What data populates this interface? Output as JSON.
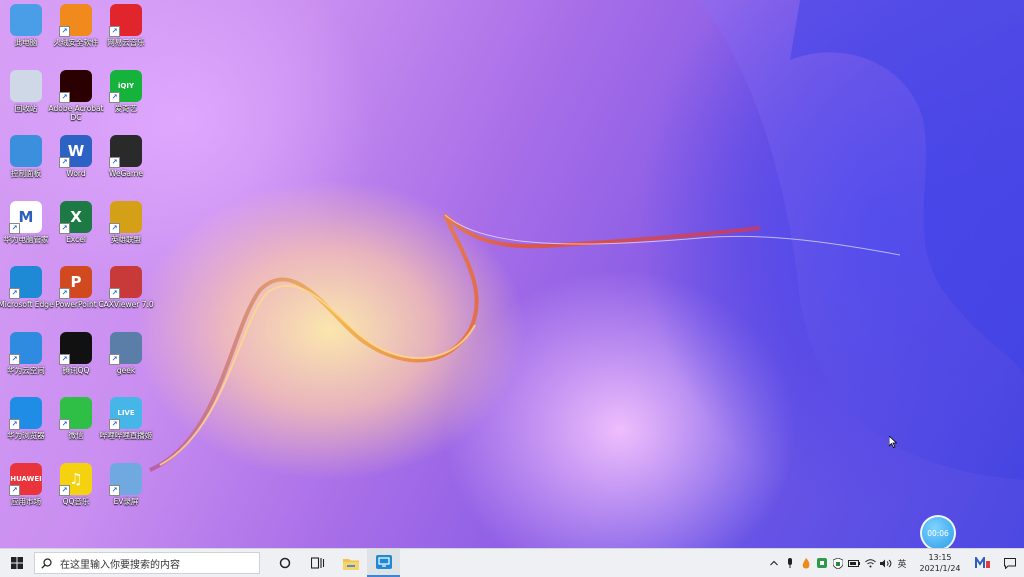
{
  "desktop": {
    "icons": [
      {
        "label": "此电脑",
        "glyph": "",
        "color": "#4a9ee8",
        "shortcut": false
      },
      {
        "label": "火绒安全软件",
        "glyph": "",
        "color": "#f08a1c",
        "shortcut": true
      },
      {
        "label": "网易云音乐",
        "glyph": "",
        "color": "#e0262c",
        "shortcut": true
      },
      {
        "label": "回收站",
        "glyph": "",
        "color": "#cfd8e6",
        "shortcut": false
      },
      {
        "label": "Adobe Acrobat DC",
        "glyph": "",
        "color": "#2b0000",
        "shortcut": true
      },
      {
        "label": "爱奇艺",
        "glyph": "iQIY",
        "color": "#16b33c",
        "shortcut": true
      },
      {
        "label": "控制面板",
        "glyph": "",
        "color": "#3c8fdc",
        "shortcut": false
      },
      {
        "label": "Word",
        "glyph": "W",
        "color": "#2b62c4",
        "shortcut": true
      },
      {
        "label": "WeGame",
        "glyph": "",
        "color": "#2a2a2a",
        "shortcut": true
      },
      {
        "label": "华为电脑管家",
        "glyph": "M",
        "color": "#ffffff",
        "shortcut": true
      },
      {
        "label": "Excel",
        "glyph": "X",
        "color": "#1d7a44",
        "shortcut": true
      },
      {
        "label": "英雄联盟",
        "glyph": "",
        "color": "#d4a018",
        "shortcut": true
      },
      {
        "label": "Microsoft Edge",
        "glyph": "",
        "color": "#1e8ad6",
        "shortcut": true
      },
      {
        "label": "PowerPoint",
        "glyph": "P",
        "color": "#d1491f",
        "shortcut": true
      },
      {
        "label": "CAXViewer 7.0",
        "glyph": "",
        "color": "#c83a3a",
        "shortcut": true
      },
      {
        "label": "华为云空间",
        "glyph": "",
        "color": "#2f8be0",
        "shortcut": true
      },
      {
        "label": "腾讯QQ",
        "glyph": "",
        "color": "#111111",
        "shortcut": true
      },
      {
        "label": "geek",
        "glyph": "",
        "color": "#5a7ea8",
        "shortcut": true
      },
      {
        "label": "华为浏览器",
        "glyph": "",
        "color": "#1f8de6",
        "shortcut": true
      },
      {
        "label": "微信",
        "glyph": "",
        "color": "#2fbf46",
        "shortcut": true
      },
      {
        "label": "哔哩哔哩直播姬",
        "glyph": "LIVE",
        "color": "#46b6e8",
        "shortcut": true
      },
      {
        "label": "应用市场",
        "glyph": "HUAWEI",
        "color": "#e8343a",
        "shortcut": true
      },
      {
        "label": "QQ音乐",
        "glyph": "♫",
        "color": "#f5d20f",
        "shortcut": true
      },
      {
        "label": "EV录屏",
        "glyph": "",
        "color": "#6fa9e0",
        "shortcut": true
      }
    ]
  },
  "timer": {
    "text": "00:06"
  },
  "taskbar": {
    "search_placeholder": "在这里输入你要搜索的内容",
    "ime_label": "英",
    "clock_time": "13:15",
    "clock_date": "2021/1/24"
  }
}
